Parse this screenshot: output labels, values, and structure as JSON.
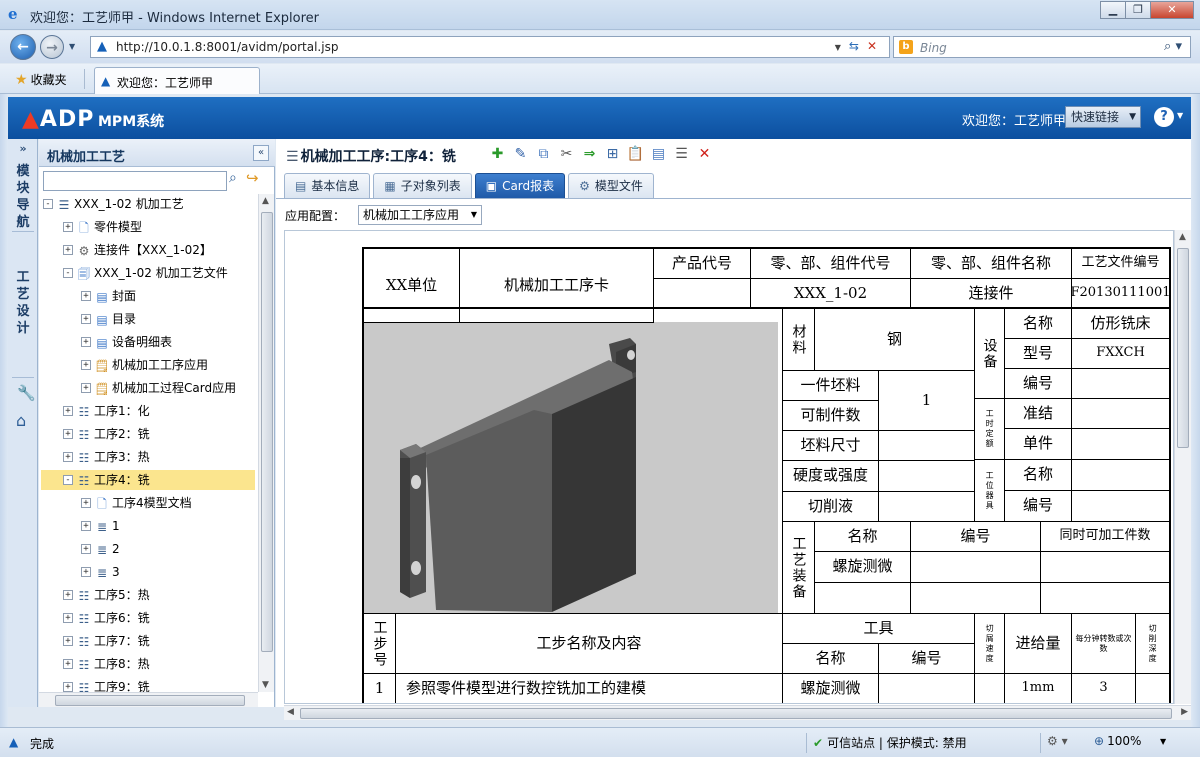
{
  "window": {
    "title": "欢迎您：工艺师甲 - Windows Internet Explorer"
  },
  "address": {
    "url": "http://10.0.1.8:8001/avidm/portal.jsp",
    "search_placeholder": "Bing"
  },
  "favbar": {
    "favorites": "收藏夹",
    "tab_title": "欢迎您：工艺师甲"
  },
  "app": {
    "logo": "ADP",
    "system": "MPM系统",
    "welcome": "欢迎您：工艺师甲",
    "quick_links": "快速链接"
  },
  "navstrip": {
    "module_nav": "模块导航",
    "process_design": "工艺设计"
  },
  "left": {
    "title": "机械加工工艺",
    "tree": [
      {
        "label": "XXX_1-02 机加工艺",
        "icon": "list-icon",
        "level": 0,
        "pm": "-"
      },
      {
        "label": "零件模型",
        "icon": "document-icon",
        "level": 1,
        "pm": "+"
      },
      {
        "label": "连接件【XXX_1-02】",
        "icon": "gear-icon",
        "level": 1,
        "pm": "+"
      },
      {
        "label": "XXX_1-02 机加工艺文件",
        "icon": "document-stack-icon",
        "level": 1,
        "pm": "-"
      },
      {
        "label": "封面",
        "icon": "form-icon",
        "level": 2,
        "pm": "+"
      },
      {
        "label": "目录",
        "icon": "form-icon",
        "level": 2,
        "pm": "+"
      },
      {
        "label": "设备明细表",
        "icon": "form-icon",
        "level": 2,
        "pm": "+"
      },
      {
        "label": "机械加工工序应用",
        "icon": "app-form-icon",
        "level": 2,
        "pm": "+"
      },
      {
        "label": "机械加工过程Card应用",
        "icon": "app-form-icon",
        "level": 2,
        "pm": "+"
      },
      {
        "label": "工序1：化",
        "icon": "process-icon",
        "level": 1,
        "pm": "+"
      },
      {
        "label": "工序2：铣",
        "icon": "process-icon",
        "level": 1,
        "pm": "+"
      },
      {
        "label": "工序3：热",
        "icon": "process-icon",
        "level": 1,
        "pm": "+"
      },
      {
        "label": "工序4：铣",
        "icon": "process-icon",
        "level": 1,
        "pm": "-",
        "selected": true
      },
      {
        "label": "工序4模型文档",
        "icon": "document-icon",
        "level": 2,
        "pm": "+"
      },
      {
        "label": "1",
        "icon": "step-icon",
        "level": 2,
        "pm": "+"
      },
      {
        "label": "2",
        "icon": "step-icon",
        "level": 2,
        "pm": "+"
      },
      {
        "label": "3",
        "icon": "step-icon",
        "level": 2,
        "pm": "+"
      },
      {
        "label": "工序5：热",
        "icon": "process-icon",
        "level": 1,
        "pm": "+"
      },
      {
        "label": "工序6：铣",
        "icon": "process-icon",
        "level": 1,
        "pm": "+"
      },
      {
        "label": "工序7：铣",
        "icon": "process-icon",
        "level": 1,
        "pm": "+"
      },
      {
        "label": "工序8：热",
        "icon": "process-icon",
        "level": 1,
        "pm": "+"
      },
      {
        "label": "工序9：铣",
        "icon": "process-icon",
        "level": 1,
        "pm": "+"
      }
    ]
  },
  "main": {
    "title": "机械加工工序:工序4：铣",
    "tabs": [
      {
        "label": "基本信息",
        "icon": "info-icon"
      },
      {
        "label": "子对象列表",
        "icon": "list-icon"
      },
      {
        "label": "Card报表",
        "icon": "card-icon",
        "active": true
      },
      {
        "label": "模型文件",
        "icon": "gear-icon"
      }
    ],
    "config_label": "应用配置：",
    "config_value": "机械加工工序应用"
  },
  "card": {
    "unit": "XX单位",
    "card_name": "机械加工工序卡",
    "h_product_code": "产品代号",
    "h_part_code": "零、部、组件代号",
    "h_part_name": "零、部、组件名称",
    "h_doc_no": "工艺文件编号",
    "v_product_code": "",
    "v_part_code": "XXX_1-02",
    "v_part_name": "连接件",
    "v_doc_no": "F20130111001",
    "material_label": "材料",
    "material_value": "钢",
    "blank_count_label1": "一件坯料",
    "blank_count_label2": "可制件数",
    "blank_count_value": "1",
    "blank_size_label": "坯料尺寸",
    "hardness_label": "硬度或强度",
    "coolant_label": "切削液",
    "equipment_label": "设备",
    "eq_name_label": "名称",
    "eq_name_value": "仿形铣床",
    "eq_model_label": "型号",
    "eq_model_value": "FXXCH",
    "eq_no_label": "编号",
    "time_label": "工时定额",
    "prep_label": "准结",
    "unit_time_label": "单件",
    "fixture_label": "工位器具",
    "fx_name_label": "名称",
    "fx_no_label": "编号",
    "tooling_label": "工艺装备",
    "tool_name_label": "名称",
    "tool_no_label": "编号",
    "tool_qty_label": "同时可加工件数",
    "tool_name_value": "螺旋测微",
    "step_no_label": "工步号",
    "step_content_label": "工步名称及内容",
    "tool_group_label": "工具",
    "step_tool_name_label": "名称",
    "step_tool_no_label": "编号",
    "speed_label": "切屑速度",
    "feed_label": "进给量",
    "rpm_label": "每分钟转数或次数",
    "depth_label": "切削深度",
    "rows": [
      {
        "no": "1",
        "content": "参照零件模型进行数控铣加工的建模",
        "tool": "螺旋测微",
        "tool_no": "",
        "speed": "",
        "feed": "1mm",
        "rpm": "3",
        "depth": ""
      }
    ]
  },
  "status": {
    "done": "完成",
    "trusted": "可信站点 | 保护模式: 禁用",
    "zoom": "100%"
  },
  "colors": {
    "header": "#1f6fc2",
    "selected_row": "#fbe58e",
    "active_tab": "#3e7fcf"
  }
}
